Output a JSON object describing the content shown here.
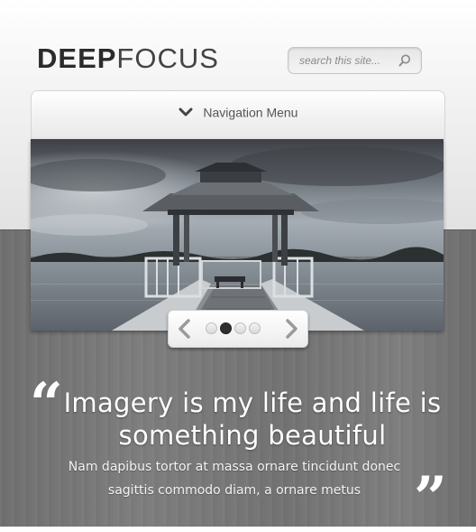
{
  "logo": {
    "part1": "DEEP",
    "part2": "FOCUS"
  },
  "search": {
    "placeholder": "search this site...",
    "icon": "magnifier-icon"
  },
  "nav": {
    "label": "Navigation Menu",
    "icon": "chevron-down-icon"
  },
  "slider": {
    "image": "lake-gazebo-pier-photo",
    "prev_icon": "chevron-left-icon",
    "next_icon": "chevron-right-icon",
    "page_count": 4,
    "active_page": 2
  },
  "testimonial": {
    "headline": "Imagery is my life and life is something beautiful",
    "body": "Nam dapibus tortor at massa ornare tincidunt donec sagittis commodo diam, a ornare metus",
    "open_quote": "“",
    "close_quote": "”"
  },
  "colors": {
    "text_dark": "#2b2b2b",
    "wood": "#777777",
    "white": "#ffffff"
  }
}
